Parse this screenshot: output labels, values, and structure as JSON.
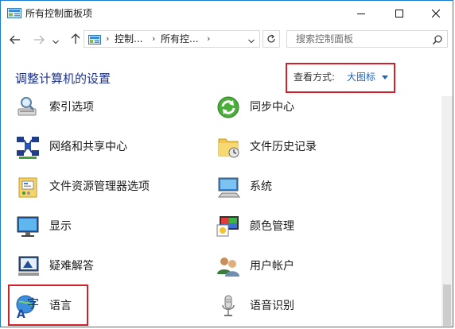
{
  "window": {
    "title": "所有控制面板项",
    "controls": {
      "minimize": "minimize-icon",
      "maximize": "maximize-icon",
      "close": "close-icon"
    }
  },
  "nav": {
    "back": "arrow-left-icon",
    "forward": "arrow-right-icon",
    "history": "chevron-down-icon",
    "up": "arrow-up-icon",
    "address": {
      "crumbs": [
        "控制...",
        "所有控..."
      ],
      "separator": "›"
    },
    "refresh": "refresh-icon",
    "search": {
      "placeholder": "搜索控制面板",
      "value": ""
    }
  },
  "header": {
    "title": "调整计算机的设置",
    "view_by_label": "查看方式:",
    "view_by_value": "大图标"
  },
  "items": [
    {
      "label": "索引选项",
      "icon": "indexing-options-icon"
    },
    {
      "label": "同步中心",
      "icon": "sync-center-icon"
    },
    {
      "label": "网络和共享中心",
      "icon": "network-sharing-center-icon"
    },
    {
      "label": "文件历史记录",
      "icon": "file-history-icon"
    },
    {
      "label": "文件资源管理器选项",
      "icon": "file-explorer-options-icon"
    },
    {
      "label": "系统",
      "icon": "system-icon"
    },
    {
      "label": "显示",
      "icon": "display-icon"
    },
    {
      "label": "颜色管理",
      "icon": "color-management-icon"
    },
    {
      "label": "疑难解答",
      "icon": "troubleshooting-icon"
    },
    {
      "label": "用户帐户",
      "icon": "user-accounts-icon"
    },
    {
      "label": "语言",
      "icon": "language-icon"
    },
    {
      "label": "语音识别",
      "icon": "speech-recognition-icon"
    }
  ],
  "colors": {
    "heading": "#1e3287",
    "link": "#1c62b9",
    "highlight": "#d0202b",
    "window_border": "#1b7cd6"
  }
}
